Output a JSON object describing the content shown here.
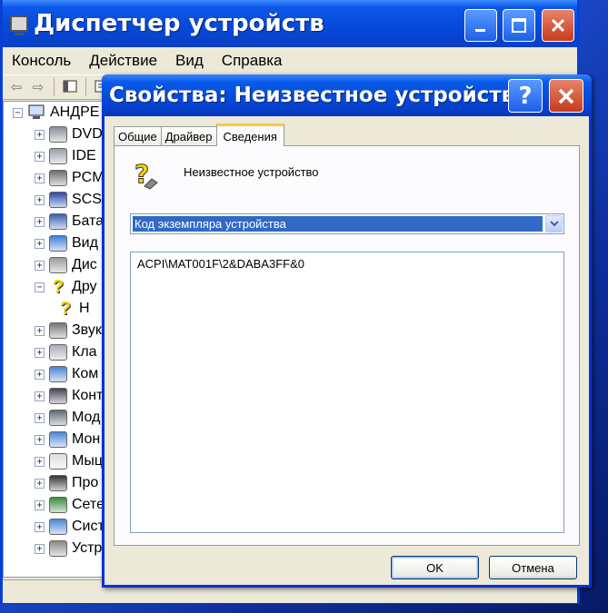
{
  "device_manager": {
    "title": "Диспетчер устройств",
    "menu": [
      "Консоль",
      "Действие",
      "Вид",
      "Справка"
    ],
    "tree": {
      "root": "АНДРЕ",
      "items": [
        {
          "label": "DVD",
          "expander": "+",
          "icon": "dvd-drive-icon"
        },
        {
          "label": "IDE",
          "expander": "+",
          "icon": "ide-controller-icon"
        },
        {
          "label": "PCM",
          "expander": "+",
          "icon": "pcmcia-icon"
        },
        {
          "label": "SCS",
          "expander": "+",
          "icon": "scsi-icon"
        },
        {
          "label": "Бата",
          "expander": "+",
          "icon": "battery-icon"
        },
        {
          "label": "Вид",
          "expander": "+",
          "icon": "video-adapter-icon"
        },
        {
          "label": "Дис",
          "expander": "+",
          "icon": "disk-drive-icon"
        },
        {
          "label": "Дру",
          "expander": "−",
          "icon": "other-devices-icon"
        },
        {
          "label": "Н",
          "expander": "",
          "icon": "unknown-device-icon"
        },
        {
          "label": "Звук",
          "expander": "+",
          "icon": "sound-icon"
        },
        {
          "label": "Кла",
          "expander": "+",
          "icon": "keyboard-icon"
        },
        {
          "label": "Ком",
          "expander": "+",
          "icon": "computer-icon"
        },
        {
          "label": "Конт",
          "expander": "+",
          "icon": "usb-controller-icon"
        },
        {
          "label": "Мод",
          "expander": "+",
          "icon": "modem-icon"
        },
        {
          "label": "Мон",
          "expander": "+",
          "icon": "monitor-icon"
        },
        {
          "label": "Мыц",
          "expander": "+",
          "icon": "mouse-icon"
        },
        {
          "label": "Про",
          "expander": "+",
          "icon": "processor-icon"
        },
        {
          "label": "Сете",
          "expander": "+",
          "icon": "network-adapter-icon"
        },
        {
          "label": "Сист",
          "expander": "+",
          "icon": "system-devices-icon"
        },
        {
          "label": "Устр",
          "expander": "+",
          "icon": "storage-volume-icon"
        }
      ]
    }
  },
  "dialog": {
    "title": "Свойства: Неизвестное устройство",
    "help_glyph": "?",
    "tabs": [
      "Общие",
      "Драйвер",
      "Сведения"
    ],
    "active_tab": "Сведения",
    "device_name": "Неизвестное устройство",
    "property_select": "Код экземпляра устройства",
    "values": [
      "ACPI\\MAT001F\\2&DABA3FF&0"
    ],
    "ok_label": "OK",
    "cancel_label": "Отмена"
  },
  "colors": {
    "xp_blue": "#0a5ae8",
    "close_red": "#c43c1c",
    "selection": "#316ac5",
    "window_bg": "#ece9d8"
  }
}
